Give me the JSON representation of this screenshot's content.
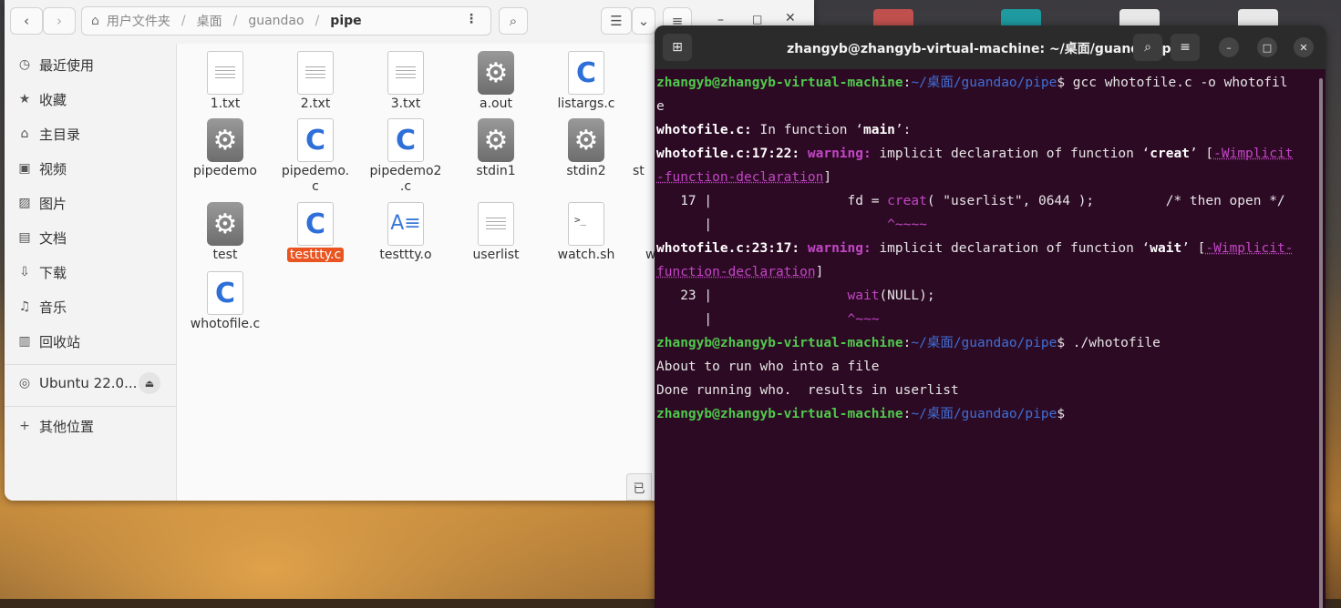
{
  "desktop": {
    "icon_colors": [
      "#c0504d",
      "#1e9aa0",
      "#e8e8e8",
      "#e8e8e8"
    ]
  },
  "file_manager": {
    "path": {
      "segments": [
        "用户文件夹",
        "桌面",
        "guandao",
        "pipe"
      ]
    },
    "sidebar": {
      "items": [
        {
          "icon": "clock-icon",
          "label": "最近使用"
        },
        {
          "icon": "star-icon",
          "label": "收藏"
        },
        {
          "icon": "home-icon",
          "label": "主目录"
        },
        {
          "icon": "video-icon",
          "label": "视频"
        },
        {
          "icon": "image-icon",
          "label": "图片"
        },
        {
          "icon": "document-icon",
          "label": "文档"
        },
        {
          "icon": "download-icon",
          "label": "下载"
        },
        {
          "icon": "music-icon",
          "label": "音乐"
        },
        {
          "icon": "trash-icon",
          "label": "回收站"
        }
      ],
      "volume": {
        "label": "Ubuntu 22.0..."
      },
      "other_locations": {
        "label": "其他位置"
      }
    },
    "files": [
      {
        "name": "1.txt",
        "type": "text"
      },
      {
        "name": "2.txt",
        "type": "text"
      },
      {
        "name": "3.txt",
        "type": "text"
      },
      {
        "name": "a.out",
        "type": "exec"
      },
      {
        "name": "listargs.c",
        "type": "c"
      },
      {
        "name": "pipedemo",
        "type": "exec"
      },
      {
        "name": "pipedemo.\nc",
        "type": "c"
      },
      {
        "name": "pipedemo2\n.c",
        "type": "c"
      },
      {
        "name": "stdin1",
        "type": "exec"
      },
      {
        "name": "stdin2",
        "type": "exec"
      },
      {
        "name": "st",
        "type": "exec"
      },
      {
        "name": "test",
        "type": "exec"
      },
      {
        "name": "testtty.c",
        "type": "c",
        "selected": true
      },
      {
        "name": "testtty.o",
        "type": "object"
      },
      {
        "name": "userlist",
        "type": "text"
      },
      {
        "name": "watch.sh",
        "type": "shell"
      },
      {
        "name": "w",
        "type": "exec"
      },
      {
        "name": "whotofile.c",
        "type": "c"
      }
    ],
    "status_chip": "已"
  },
  "terminal": {
    "title": "zhangyb@zhangyb-virtual-machine: ~/桌面/guandao/pipe",
    "prompt_user": "zhangyb@zhangyb-virtual-machine",
    "prompt_path": "~/桌面/guandao/pipe",
    "lines": {
      "cmd1": "gcc whotofile.c -o whotofil",
      "cmd1_wrap": "e",
      "l2_file": "whotofile.c:",
      "l2_text": " In function ‘",
      "l2_func": "main",
      "l2_end": "’:",
      "l3_loc": "whotofile.c:17:22:",
      "l3_warn": "warning:",
      "l3_text": " implicit declaration of function ‘",
      "l3_func": "creat",
      "l3_end": "’ [",
      "l3_flag": "-Wimplicit",
      "l4_flag": "-function-declaration",
      "l4_end": "]",
      "l5_num": "   17 | ",
      "l5_pre": "                fd = ",
      "l5_fn": "creat",
      "l5_post": "( \"userlist\", 0644 );         /* then open */",
      "l6_bar": "      | ",
      "l6_caret": "                     ^~~~~",
      "l7_loc": "whotofile.c:23:17:",
      "l7_warn": "warning:",
      "l7_text": " implicit declaration of function ‘",
      "l7_func": "wait",
      "l7_end": "’ [",
      "l7_flag": "-Wimplicit-",
      "l8_flag": "function-declaration",
      "l8_end": "]",
      "l9_num": "   23 | ",
      "l9_pre": "                ",
      "l9_fn": "wait",
      "l9_post": "(NULL);",
      "l10_bar": "      | ",
      "l10_caret": "                ^~~~",
      "cmd2": "./whotofile",
      "out1": "About to run who into a file",
      "out2": "Done running who.  results in userlist"
    }
  }
}
